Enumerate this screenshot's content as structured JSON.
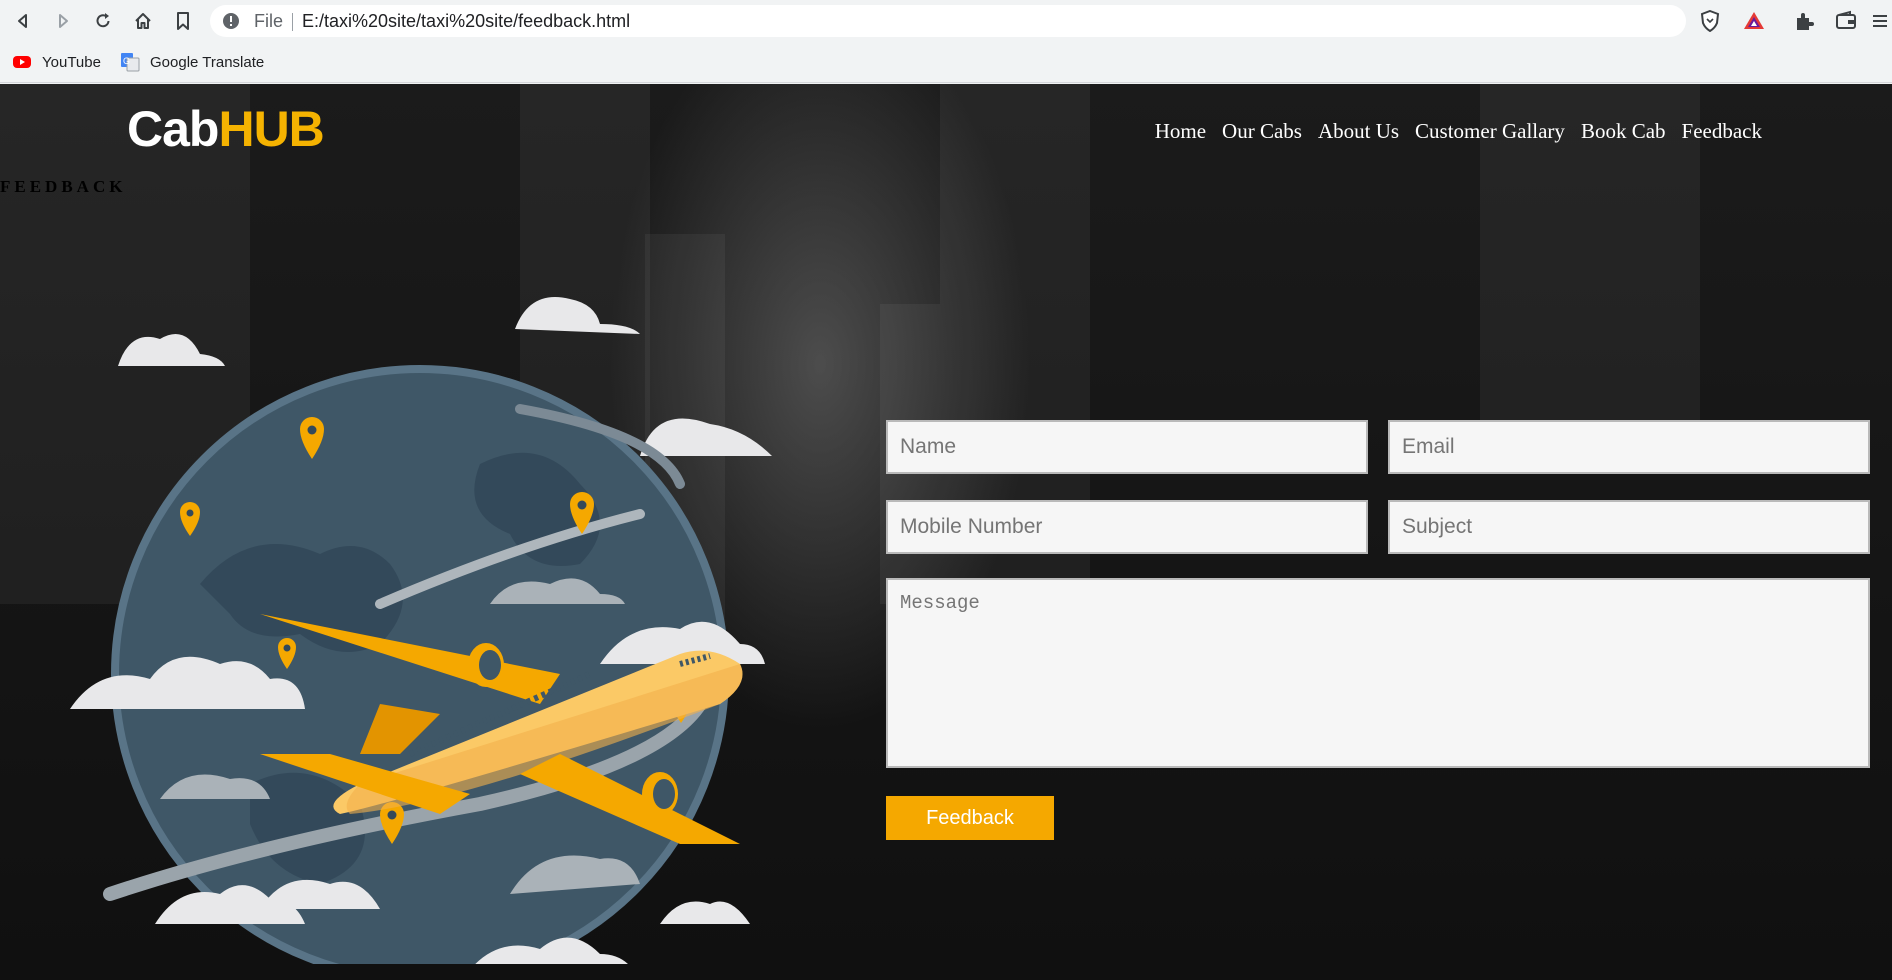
{
  "browser": {
    "file_label": "File",
    "url": "E:/taxi%20site/taxi%20site/feedback.html",
    "bookmarks": [
      {
        "label": "YouTube",
        "icon": "youtube-icon"
      },
      {
        "label": "Google Translate",
        "icon": "google-translate-icon"
      }
    ]
  },
  "site": {
    "logo_part1": "Cab",
    "logo_part2": "HUB",
    "section_label": "FEEDBACK",
    "nav": [
      "Home",
      "Our Cabs",
      "About Us",
      "Customer Gallary",
      "Book Cab",
      "Feedback"
    ]
  },
  "form": {
    "name_placeholder": "Name",
    "email_placeholder": "Email",
    "mobile_placeholder": "Mobile Number",
    "subject_placeholder": "Subject",
    "message_placeholder": "Message",
    "submit_label": "Feedback"
  },
  "colors": {
    "accent": "#f5a800",
    "logo_accent": "#f5b301",
    "page_bg": "#151515",
    "globe": "#3d5566",
    "plane": "#f5a800"
  }
}
